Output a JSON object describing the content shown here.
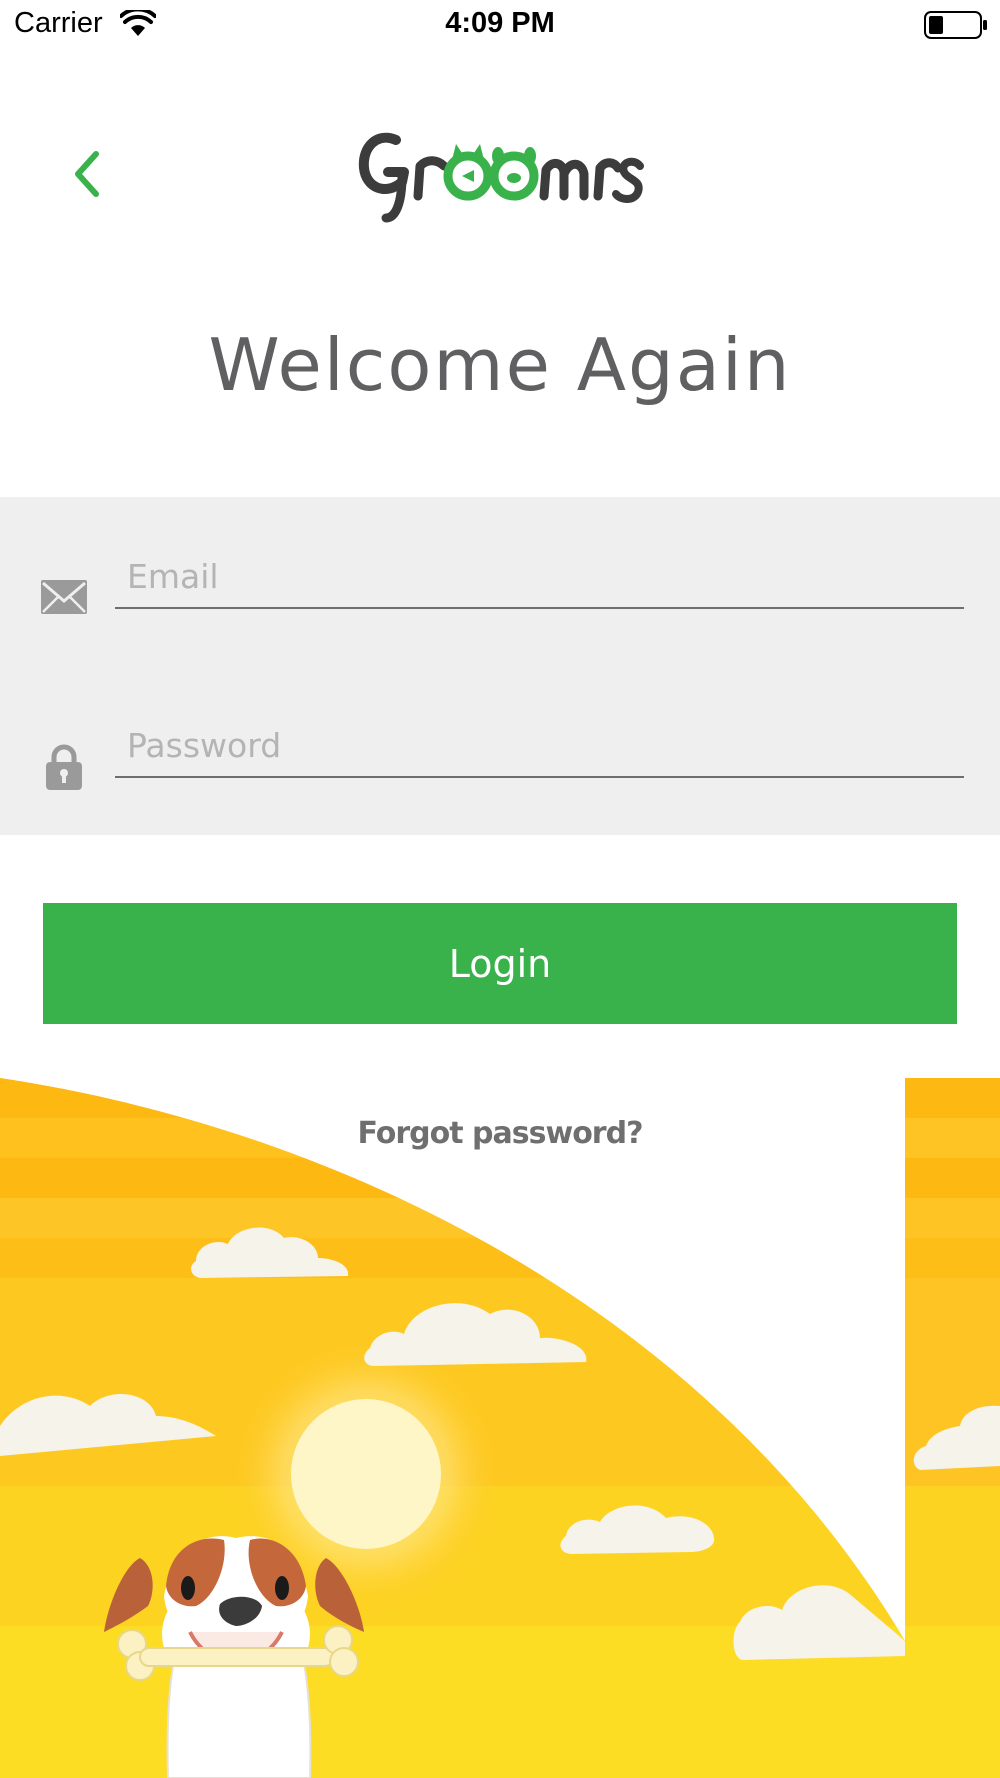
{
  "status_bar": {
    "carrier": "Carrier",
    "time": "4:09 PM",
    "wifi_icon": "wifi-icon",
    "battery_icon": "battery-icon"
  },
  "header": {
    "back_icon": "chevron-left-icon",
    "logo_text": "Groomrs"
  },
  "welcome": {
    "title": "Welcome Again"
  },
  "form": {
    "email": {
      "placeholder": "Email",
      "value": "",
      "icon": "envelope-icon"
    },
    "password": {
      "placeholder": "Password",
      "value": "",
      "icon": "lock-icon"
    }
  },
  "actions": {
    "login_label": "Login",
    "forgot_label": "Forgot password?"
  },
  "colors": {
    "accent_green": "#3ab24b",
    "title_gray": "#606062",
    "panel_gray": "#efefef",
    "sky_yellow": "#fdc214"
  }
}
